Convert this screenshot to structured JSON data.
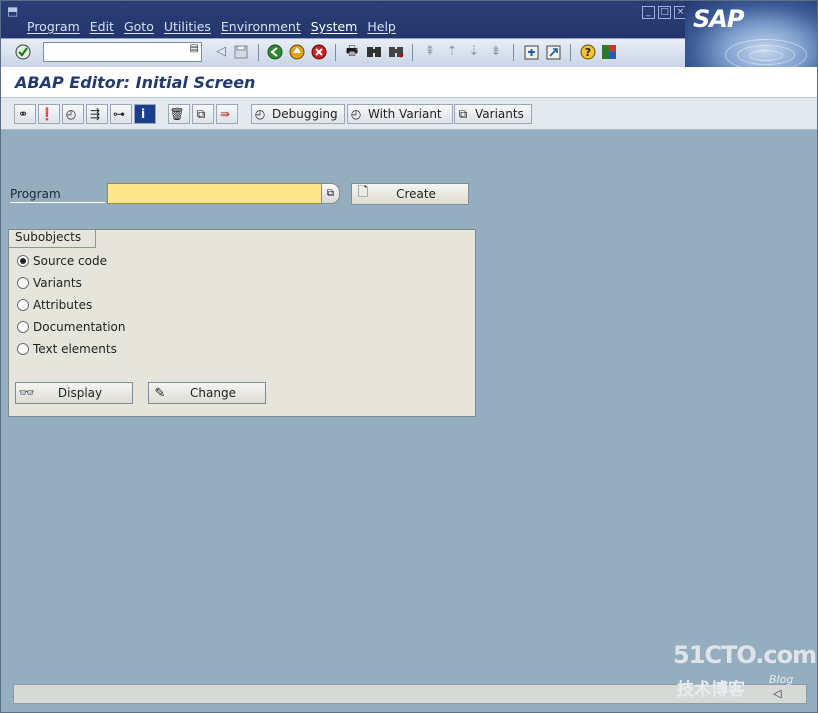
{
  "window": {
    "menu": [
      "Program",
      "Edit",
      "Goto",
      "Utilities",
      "Environment",
      "System",
      "Help"
    ],
    "brand": "SAP"
  },
  "toolbar": {
    "command_value": "",
    "icons": [
      "enter-icon",
      "back-arrow-icon",
      "save-icon",
      "back-icon",
      "exit-icon",
      "cancel-icon",
      "print-icon",
      "find-icon",
      "find-next-icon",
      "first-page-icon",
      "previous-page-icon",
      "next-page-icon",
      "last-page-icon",
      "create-session-icon",
      "shortcut-icon",
      "help-icon",
      "layout-icon"
    ]
  },
  "screen": {
    "title": "ABAP Editor: Initial Screen"
  },
  "app_toolbar": {
    "buttons": [
      {
        "icon": "other-object-icon"
      },
      {
        "icon": "check-icon"
      },
      {
        "icon": "activate-icon"
      },
      {
        "icon": "where-used-icon"
      },
      {
        "icon": "object-list-icon"
      },
      {
        "icon": "info-icon"
      },
      {
        "icon": "delete-icon"
      },
      {
        "icon": "copy-icon"
      },
      {
        "icon": "rename-icon"
      }
    ],
    "debugging": "Debugging",
    "with_variant": "With Variant",
    "variants": "Variants"
  },
  "form": {
    "program_label": "Program",
    "program_value": "",
    "create": "Create"
  },
  "subobjects": {
    "title": "Subobjects",
    "options": [
      {
        "label": "Source code",
        "selected": true
      },
      {
        "label": "Variants",
        "selected": false
      },
      {
        "label": "Attributes",
        "selected": false
      },
      {
        "label": "Documentation",
        "selected": false
      },
      {
        "label": "Text elements",
        "selected": false
      }
    ],
    "display": "Display",
    "change": "Change"
  },
  "watermark": {
    "site": "51CTO.com",
    "tagline": "技术博客",
    "blog": "Blog"
  },
  "colors": {
    "menubar": "#22366c",
    "background": "#94aec0",
    "input_required": "#fde68a"
  }
}
